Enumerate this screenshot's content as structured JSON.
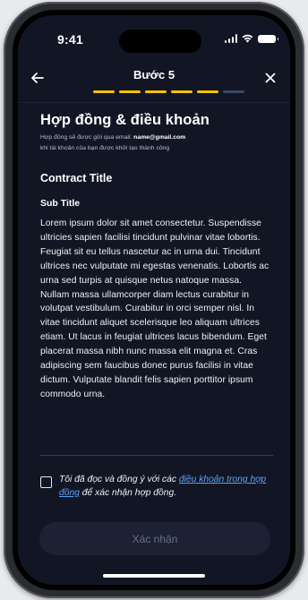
{
  "status_bar": {
    "time": "9:41"
  },
  "header": {
    "step_title": "Bước 5",
    "progress": {
      "completed_steps": 5,
      "total_steps": 6
    },
    "colors": {
      "active": "#f5c400",
      "inactive": "#3a4664"
    }
  },
  "content": {
    "page_title": "Hợp đồng & điều khoản",
    "subtitle_line1_prefix": "Hợp đồng sẽ được gửi qua email: ",
    "subtitle_email": "name@gmail.com",
    "subtitle_line2": "khi tài khoản của bạn được khởi tạo thành công",
    "contract_title": "Contract Title",
    "sub_title": "Sub Title",
    "body": "Lorem ipsum dolor sit amet consectetur. Suspendisse ultricies sapien facilisi tincidunt pulvinar vitae lobortis. Feugiat sit eu tellus nascetur ac in urna dui. Tincidunt ultrices nec vulputate mi egestas venenatis. Lobortis ac urna sed turpis at quisque netus natoque massa. Nullam massa ullamcorper diam lectus curabitur in volutpat vestibulum. Curabitur in orci semper nisl. In vitae tincidunt aliquet scelerisque leo aliquam ultrices etiam. Ut lacus in feugiat ultrices lacus bibendum. Eget placerat massa nibh nunc massa elit magna et. Cras adipiscing sem faucibus donec purus facilisi in vitae dictum. Vulputate blandit felis sapien porttitor ipsum commodo urna."
  },
  "agreement": {
    "checked": false,
    "text_before": "Tôi đã đọc và đồng ý với các ",
    "link_text": "điều khoản trong hợp đồng",
    "text_after": " để xác nhận hợp đồng."
  },
  "confirm_button": {
    "label": "Xác nhận",
    "enabled": false
  },
  "icons": {
    "back": "arrow-left-icon",
    "close": "close-icon",
    "signal": "cellular-signal-icon",
    "wifi": "wifi-icon",
    "battery": "battery-icon"
  }
}
